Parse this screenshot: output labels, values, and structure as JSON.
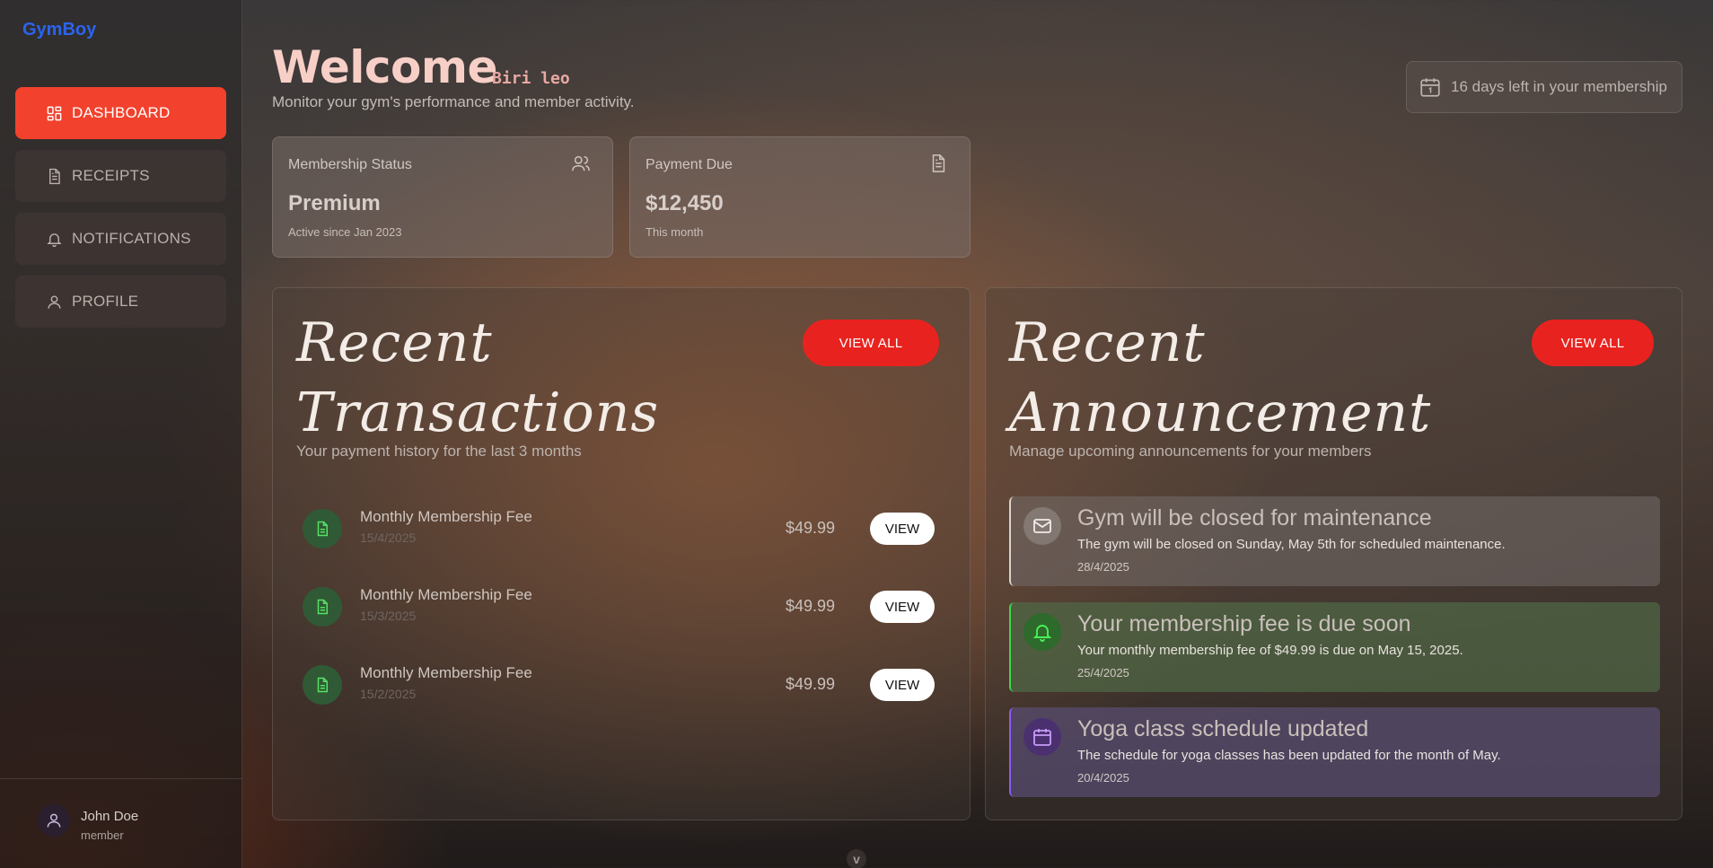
{
  "app": {
    "logo": "GymBoy"
  },
  "sidebar": {
    "items": [
      {
        "label": "DASHBOARD",
        "icon": "dashboard-icon",
        "active": true
      },
      {
        "label": "RECEIPTS",
        "icon": "receipt-icon",
        "active": false
      },
      {
        "label": "NOTIFICATIONS",
        "icon": "bell-icon",
        "active": false
      },
      {
        "label": "PROFILE",
        "icon": "user-icon",
        "active": false
      }
    ],
    "user": {
      "name": "John Doe",
      "role": "member"
    }
  },
  "header": {
    "welcome": "Welcome",
    "username": "Biri leo",
    "subtitle": "Monitor your gym's performance and member activity.",
    "membership_notice": "16 days left in your membership"
  },
  "stats": {
    "membership": {
      "label": "Membership Status",
      "value": "Premium",
      "note": "Active since Jan 2023",
      "icon": "users-icon"
    },
    "payment": {
      "label": "Payment Due",
      "value": "$12,450",
      "note": "This month",
      "icon": "document-icon"
    }
  },
  "transactions": {
    "title_line1": "Recent",
    "title_line2": "Transactions",
    "subtitle": "Your payment history for the last 3 months",
    "view_all": "VIEW ALL",
    "items": [
      {
        "title": "Monthly Membership Fee",
        "date": "15/4/2025",
        "amount": "$49.99",
        "action": "VIEW"
      },
      {
        "title": "Monthly Membership Fee",
        "date": "15/3/2025",
        "amount": "$49.99",
        "action": "VIEW"
      },
      {
        "title": "Monthly Membership Fee",
        "date": "15/2/2025",
        "amount": "$49.99",
        "action": "VIEW"
      }
    ]
  },
  "announcements": {
    "title_line1": "Recent",
    "title_line2": "Announcement",
    "subtitle": "Manage upcoming announcements for your members",
    "view_all": "VIEW ALL",
    "items": [
      {
        "title": "Gym will be closed for maintenance",
        "desc": "The gym will be closed on Sunday, May 5th for scheduled maintenance.",
        "date": "28/4/2025",
        "icon": "mail-icon",
        "accent": "#d8d2ce"
      },
      {
        "title": "Your membership fee is due soon",
        "desc": "Your monthly membership fee of $49.99 is due on May 15, 2025.",
        "date": "25/4/2025",
        "icon": "bell-icon",
        "accent": "#3fd64a"
      },
      {
        "title": "Yoga class schedule updated",
        "desc": "The schedule for yoga classes has been updated for the month of May.",
        "date": "20/4/2025",
        "icon": "calendar-icon",
        "accent": "#8a5cf0"
      }
    ]
  },
  "colors": {
    "accent_red": "#f2412c",
    "logo_blue": "#2b64ee",
    "success_green": "#3fd64a"
  }
}
